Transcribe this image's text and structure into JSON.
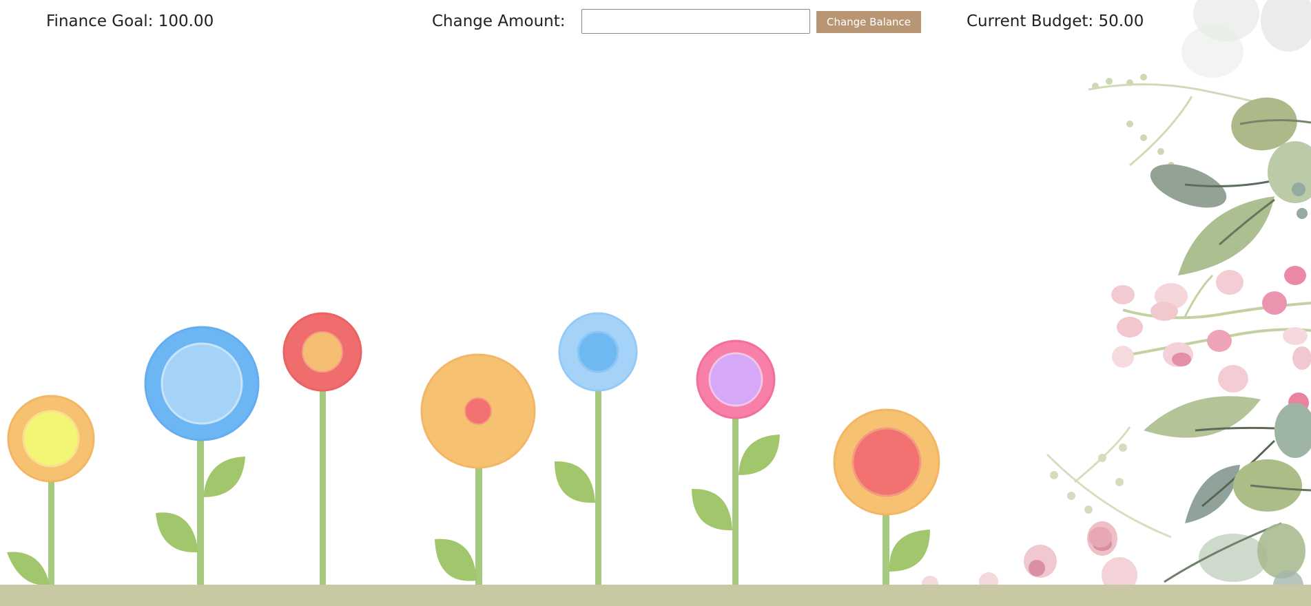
{
  "header": {
    "goal_label": "Finance Goal: 100.00",
    "change_label": "Change Amount:",
    "amount_input_value": "",
    "amount_input_placeholder": "",
    "change_button_label": "Change Balance",
    "budget_label": "Current Budget: 50.00"
  },
  "colors": {
    "button": "#b89673",
    "ground": "#c8c9a2",
    "stem": "#a5c97d",
    "leaf": "#a2c66c"
  },
  "flowers": [
    {
      "name": "flower-orange-yellow",
      "petal": "#f6c272",
      "center": "#f3f575",
      "center_ring": "#fbdf90"
    },
    {
      "name": "flower-blue-lightblue",
      "petal": "#6cb6f3",
      "center": "#a5d3f8",
      "center_ring": "#c8e4fa"
    },
    {
      "name": "flower-red-orange",
      "petal": "#f06d6d",
      "center": "#f6be72",
      "center_ring": "#f59a8a"
    },
    {
      "name": "flower-orange-red",
      "petal": "#f6c272",
      "center": "#f27171",
      "center_ring": "#f49a7e"
    },
    {
      "name": "flower-lightblue-blue",
      "petal": "#a5d3f8",
      "center": "#6fb9f3",
      "center_ring": "#8cc6f6"
    },
    {
      "name": "flower-pink-purple",
      "petal": "#f77fa8",
      "center": "#d6a8f8",
      "center_ring": "#f2c4e6"
    },
    {
      "name": "flower-orange-red-large",
      "petal": "#f6c272",
      "center": "#f27171",
      "center_ring": "#f49a7e"
    }
  ],
  "decor": {
    "foliage_icon": "botanical-foliage-icon"
  }
}
